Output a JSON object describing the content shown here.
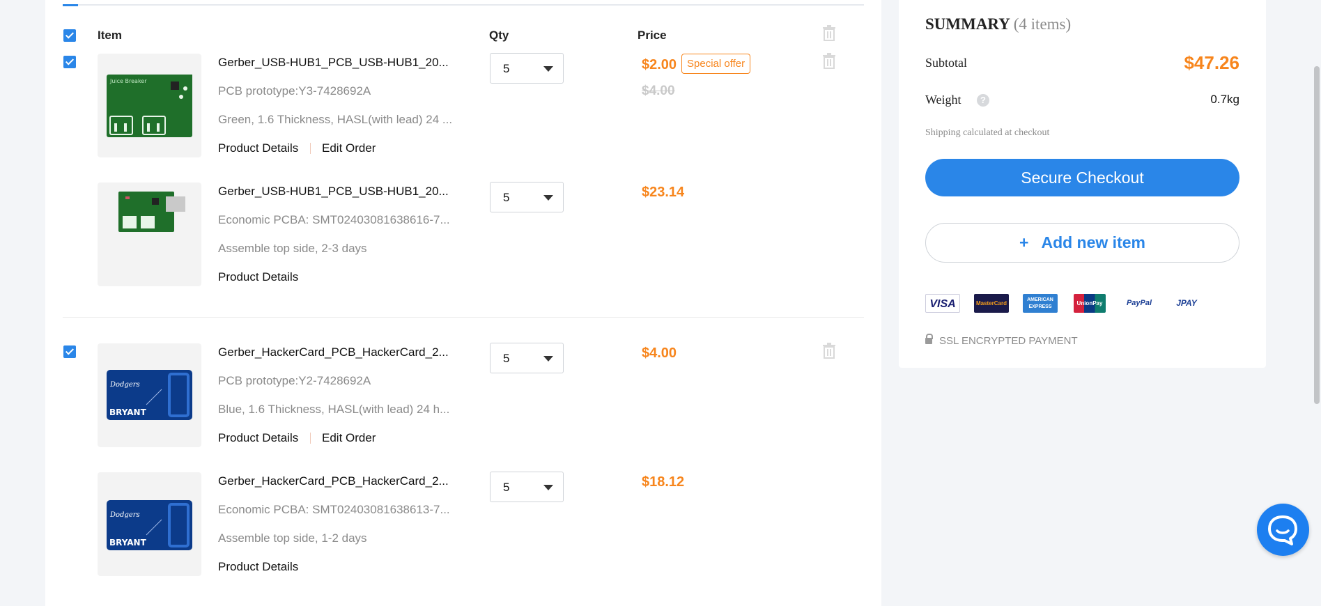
{
  "cart": {
    "headers": {
      "item": "Item",
      "qty": "Qty",
      "price": "Price"
    },
    "items": [
      {
        "title": "Gerber_USB-HUB1_PCB_USB-HUB1_20...",
        "subtitle": "PCB prototype:Y3-7428692A",
        "spec": "Green, 1.6 Thickness, HASL(with lead) 24 ...",
        "details_link": "Product Details",
        "edit_link": "Edit Order",
        "qty": "5",
        "price": "$2.00",
        "offer": "Special offer",
        "old_price": "$4.00"
      },
      {
        "title": "Gerber_USB-HUB1_PCB_USB-HUB1_20...",
        "subtitle": "Economic PCBA: SMT02403081638616-7...",
        "spec": "Assemble top side, 2-3 days",
        "details_link": "Product Details",
        "qty": "5",
        "price": "$23.14"
      },
      {
        "title": "Gerber_HackerCard_PCB_HackerCard_2...",
        "subtitle": "PCB prototype:Y2-7428692A",
        "spec": "Blue, 1.6 Thickness, HASL(with lead) 24 h...",
        "details_link": "Product Details",
        "edit_link": "Edit Order",
        "qty": "5",
        "price": "$4.00"
      },
      {
        "title": "Gerber_HackerCard_PCB_HackerCard_2...",
        "subtitle": "Economic PCBA: SMT02403081638613-7...",
        "spec": "Assemble top side, 1-2 days",
        "details_link": "Product Details",
        "qty": "5",
        "price": "$18.12"
      }
    ],
    "board_text": {
      "pcb_green": "Juice Breaker",
      "pcb_blue": "BRYANT"
    }
  },
  "summary": {
    "title": "SUMMARY",
    "count": "(4 items)",
    "subtotal_label": "Subtotal",
    "subtotal_value": "$47.26",
    "weight_label": "Weight",
    "weight_value": "0.7kg",
    "help_glyph": "?",
    "shipping_note": "Shipping calculated at checkout",
    "checkout_label": "Secure Checkout",
    "add_plus": "+",
    "add_label": "Add new item",
    "payment_logos": [
      "VISA",
      "MasterCard",
      "AMERICAN EXPRESS",
      "UnionPay",
      "PayPal",
      "JPAY"
    ],
    "ssl_label": "SSL ENCRYPTED PAYMENT"
  },
  "colors": {
    "accent": "#2a86e8",
    "price": "#f7851c",
    "muted": "#8a8a8a"
  }
}
